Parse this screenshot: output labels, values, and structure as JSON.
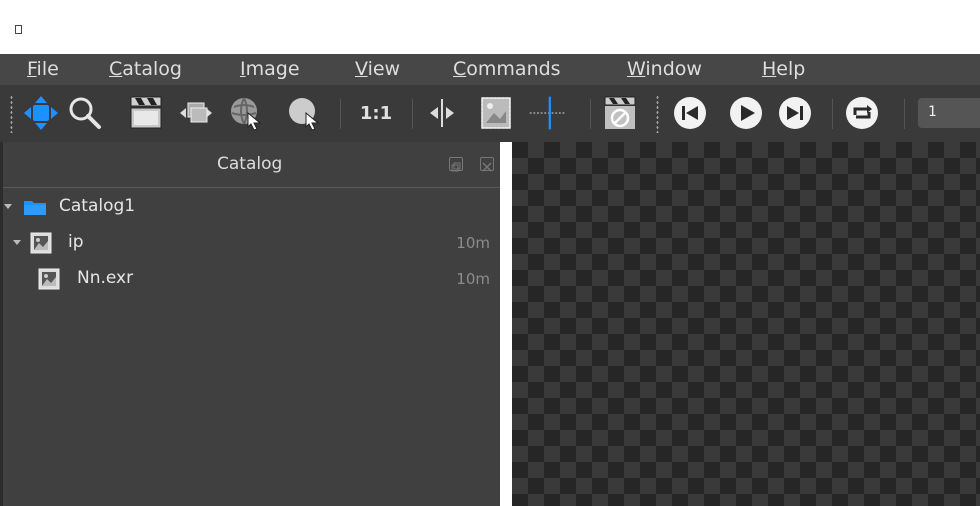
{
  "menu": {
    "items": [
      {
        "label": "File"
      },
      {
        "label": "Catalog"
      },
      {
        "label": "Image"
      },
      {
        "label": "View"
      },
      {
        "label": "Commands"
      },
      {
        "label": "Window"
      },
      {
        "label": "Help"
      }
    ]
  },
  "toolbar": {
    "zoom_ratio_label": "1:1",
    "frame_value": "1"
  },
  "catalog_panel": {
    "title": "Catalog",
    "rows": [
      {
        "label": "Catalog1",
        "size": ""
      },
      {
        "label": "ip",
        "size": "10m"
      },
      {
        "label": "Nn.exr",
        "size": "10m"
      }
    ]
  },
  "colors": {
    "accent": "#1e90ff",
    "menubar": "#474747",
    "toolbar": "#3a3a3a",
    "panel": "#404040",
    "checker_dark": "#262626",
    "checker_light": "#3a3a3a"
  }
}
